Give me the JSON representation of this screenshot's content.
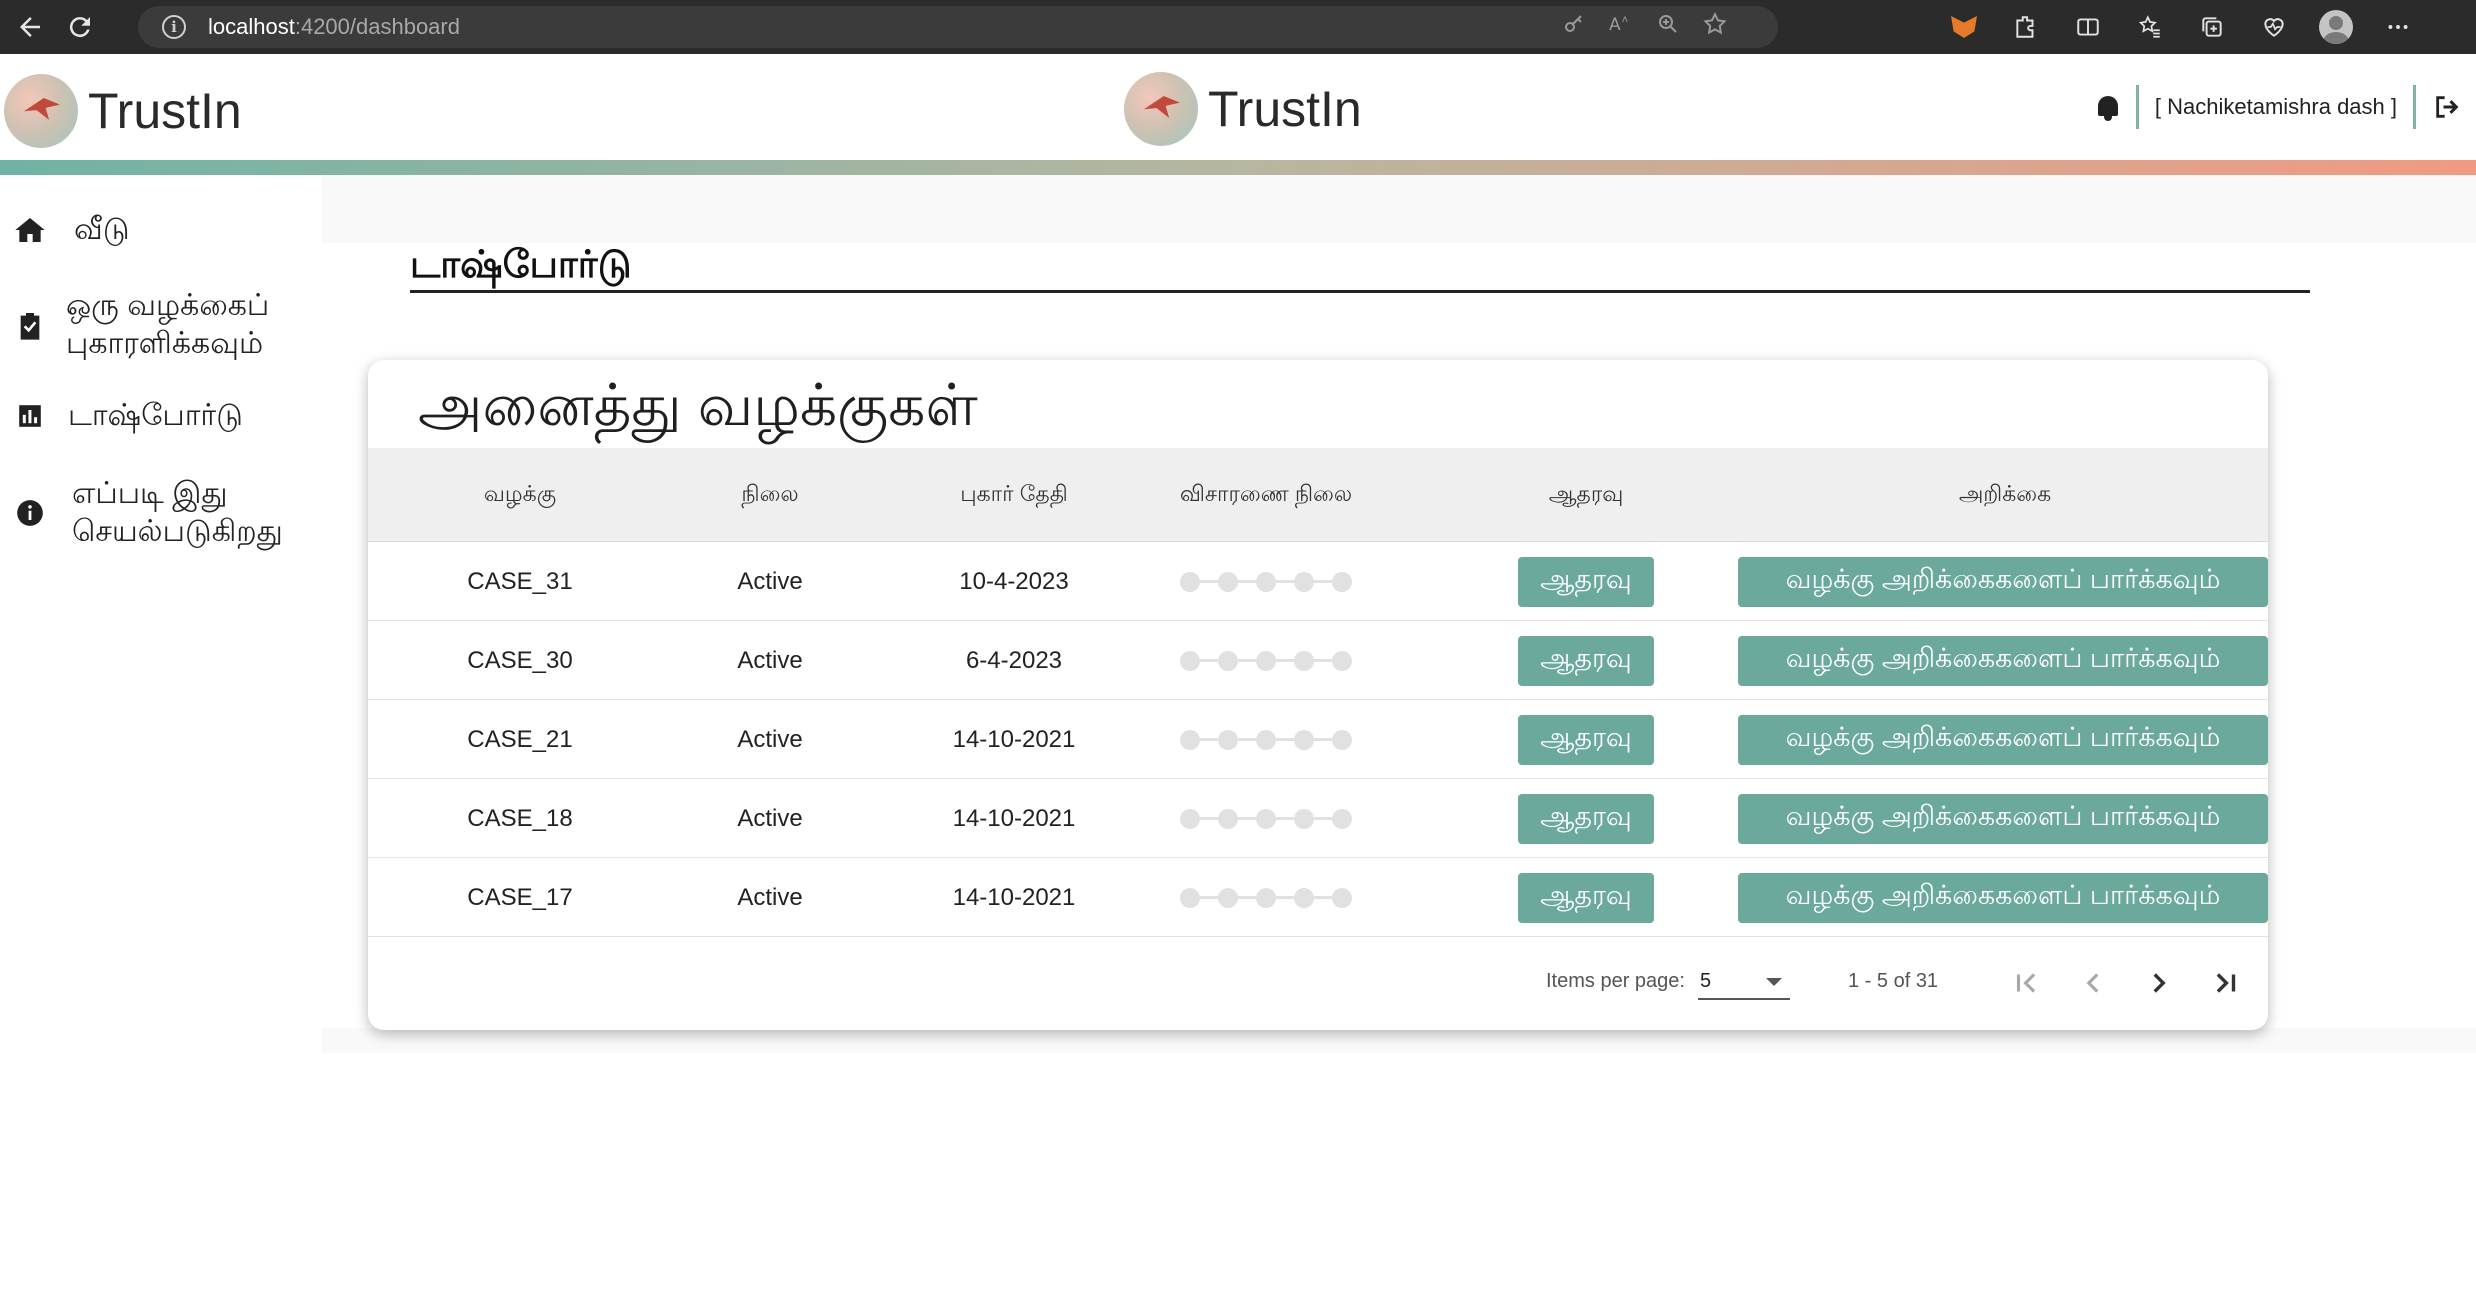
{
  "browser": {
    "url_host": "localhost",
    "url_rest": ":4200/dashboard"
  },
  "header": {
    "brand_left": "TrustIn",
    "brand_center": "TrustIn",
    "username": "[ Nachiketamishra dash ]"
  },
  "sidebar": {
    "items": [
      {
        "label": "வீடு",
        "icon": "home-icon"
      },
      {
        "label": "ஒரு வழக்கைப் புகாரளிக்கவும்",
        "icon": "clipboard-check-icon"
      },
      {
        "label": "டாஷ்போர்டு",
        "icon": "bar-chart-icon"
      },
      {
        "label": "எப்படி இது செயல்படுகிறது",
        "icon": "info-icon"
      }
    ]
  },
  "main": {
    "page_title": "டாஷ்போர்டு",
    "card_title": "அனைத்து வழக்குகள்",
    "columns": [
      "வழக்கு",
      "நிலை",
      "புகார் தேதி",
      "விசாரணை நிலை",
      "ஆதரவு",
      "அறிக்கை"
    ],
    "rows": [
      {
        "case": "CASE_31",
        "status": "Active",
        "date": "10-4-2023",
        "support": "ஆதரவு",
        "report": "வழக்கு அறிக்கைகளைப் பார்க்கவும்"
      },
      {
        "case": "CASE_30",
        "status": "Active",
        "date": "6-4-2023",
        "support": "ஆதரவு",
        "report": "வழக்கு அறிக்கைகளைப் பார்க்கவும்"
      },
      {
        "case": "CASE_21",
        "status": "Active",
        "date": "14-10-2021",
        "support": "ஆதரவு",
        "report": "வழக்கு அறிக்கைகளைப் பார்க்கவும்"
      },
      {
        "case": "CASE_18",
        "status": "Active",
        "date": "14-10-2021",
        "support": "ஆதரவு",
        "report": "வழக்கு அறிக்கைகளைப் பார்க்கவும்"
      },
      {
        "case": "CASE_17",
        "status": "Active",
        "date": "14-10-2021",
        "support": "ஆதரவு",
        "report": "வழக்கு அறிக்கைகளைப் பார்க்கவும்"
      }
    ],
    "investigation_steps": 5,
    "paginator": {
      "items_per_page_label": "Items per page:",
      "items_per_page_value": "5",
      "range": "1 - 5 of 31"
    }
  },
  "colors": {
    "accent": "#6aa99b",
    "gradient_start": "#6fb3a4",
    "gradient_end": "#f19a82"
  }
}
